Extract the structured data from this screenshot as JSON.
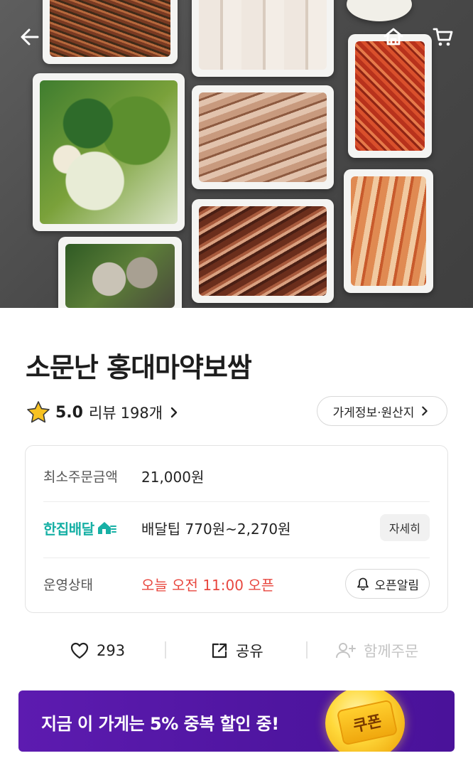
{
  "store": {
    "name": "소문난 홍대마약보쌈",
    "rating": "5.0",
    "review_label": "리뷰",
    "review_count": "198개",
    "info_button": "가게정보·원산지"
  },
  "info_card": {
    "min_order_label": "최소주문금액",
    "min_order_value": "21,000원",
    "delivery_brand": "한집배달",
    "delivery_tip": "배달팁 770원~2,270원",
    "detail_button": "자세히",
    "status_label": "운영상태",
    "status_value": "오늘 오전 11:00 오픈",
    "alarm_button": "오픈알림"
  },
  "actions": {
    "like_count": "293",
    "share_label": "공유",
    "group_order_label": "함께주문"
  },
  "banner": {
    "text": "지금 이 가게는 5% 중복 할인 중!",
    "coupon_label": "쿠폰"
  },
  "colors": {
    "accent_teal": "#17b0a5",
    "status_red": "#e8473f",
    "banner_purple": "#5d1bb0",
    "star_yellow": "#f7c221"
  },
  "icons": [
    "back-arrow-icon",
    "home-icon",
    "cart-icon",
    "star-icon",
    "chevron-right-icon",
    "home-delivery-icon",
    "bell-icon",
    "heart-icon",
    "share-icon",
    "add-person-icon",
    "coupon-icon"
  ]
}
